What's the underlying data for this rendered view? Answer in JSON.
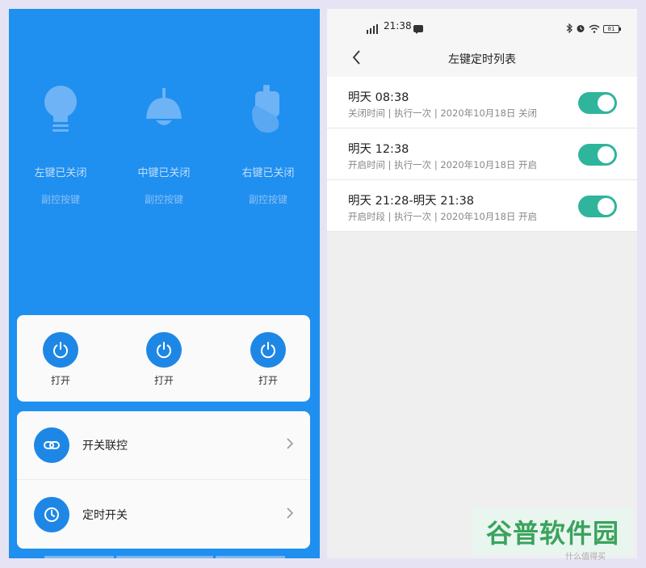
{
  "left": {
    "devices": [
      {
        "name": "左键已关闭",
        "sub": "副控按键",
        "icon": "bulb-icon"
      },
      {
        "name": "中键已关闭",
        "sub": "副控按键",
        "icon": "pendant-lamp-icon"
      },
      {
        "name": "右键已关闭",
        "sub": "副控按键",
        "icon": "hand-switch-icon"
      }
    ],
    "power_buttons": [
      {
        "label": "打开",
        "icon": "power-icon"
      },
      {
        "label": "打开",
        "icon": "power-icon"
      },
      {
        "label": "打开",
        "icon": "power-icon"
      }
    ],
    "menu": [
      {
        "label": "开关联控",
        "icon": "link-icon"
      },
      {
        "label": "定时开关",
        "icon": "clock-icon"
      }
    ]
  },
  "right": {
    "status": {
      "time": "21:38",
      "battery": "81"
    },
    "title": "左键定时列表",
    "timers": [
      {
        "time": "明天 08:38",
        "desc": "关闭时间 |   执行一次 |   2020年10月18日 关闭",
        "enabled": true
      },
      {
        "time": "明天 12:38",
        "desc": "开启时间 |   执行一次 |   2020年10月18日 开启",
        "enabled": true
      },
      {
        "time": "明天 21:28-明天 21:38",
        "desc": "开启时段 |   执行一次 |   2020年10月18日 开启",
        "enabled": true
      }
    ]
  },
  "watermark": {
    "text": "谷普软件园",
    "small": "什么值得买"
  },
  "colors": {
    "primary_blue": "#1f8ff0",
    "button_blue": "#1e87e6",
    "toggle_on": "#2fb59c",
    "watermark_green": "#3aa35d"
  }
}
